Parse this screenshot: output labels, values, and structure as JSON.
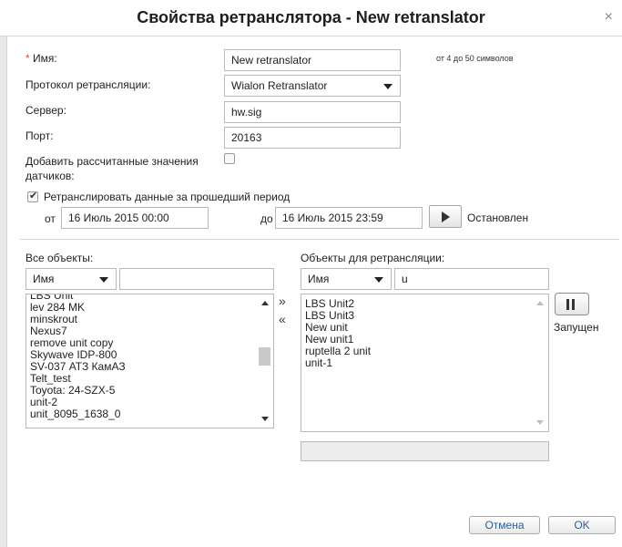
{
  "window": {
    "title": "Свойства ретранслятора - New retranslator",
    "close_icon": "×"
  },
  "form": {
    "name_required_mark": "*",
    "name_label": "Имя:",
    "name_value": "New retranslator",
    "name_hint": "от 4 до 50 символов",
    "protocol_label": "Протокол ретрансляции:",
    "protocol_value": "Wialon Retranslator",
    "server_label": "Сервер:",
    "server_value": "hw.sig",
    "port_label": "Порт:",
    "port_value": "20163",
    "sensors_label_line1": "Добавить рассчитанные значения",
    "sensors_label_line2": "датчиков:",
    "sensors_checked": false,
    "period_checked": true,
    "period_label": "Ретранслировать данные за прошедший период",
    "from_label": "от",
    "from_value": "16 Июль 2015 00:00",
    "to_label": "до",
    "to_value": "16 Июль 2015 23:59",
    "status_text": "Остановлен"
  },
  "all_objects": {
    "label": "Все объекты:",
    "filter_field": "Имя",
    "filter_value": "",
    "items": [
      "LBS Unit",
      "lev 284 MK",
      "minskrout",
      "Nexus7",
      "remove unit copy",
      "Skywave IDP-800",
      "SV-037 АТЗ КамАЗ",
      "Telt_test",
      "Toyota: 24-SZX-5",
      "unit-2",
      "unit_8095_1638_0"
    ]
  },
  "transfer": {
    "add": "»",
    "remove": "«"
  },
  "retr_objects": {
    "label": "Объекты для ретрансляции:",
    "filter_field": "Имя",
    "filter_value": "u",
    "items": [
      "LBS Unit2",
      "LBS Unit3",
      "New unit",
      "New unit1",
      "ruptella 2 unit",
      "unit-1"
    ],
    "running_status": "Запущен",
    "status_box_text": ""
  },
  "footer": {
    "cancel_label": "Отмена",
    "ok_label": "OK"
  }
}
